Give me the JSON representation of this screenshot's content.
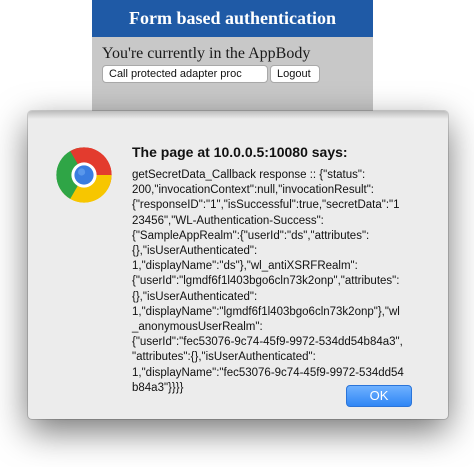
{
  "app": {
    "header_title": "Form based authentication",
    "body_text": "You're currently in the AppBody",
    "buttons": {
      "protected_label": "Call protected adapter proc",
      "logout_label": "Logout"
    }
  },
  "dialog": {
    "title": "The page at 10.0.0.5:10080 says:",
    "message": "getSecretData_Callback response :: {\"status\":\n200,\"invocationContext\":null,\"invocationResult\":\n{\"responseID\":\"1\",\"isSuccessful\":true,\"secretData\":\"1\n23456\",\"WL-Authentication-Success\":\n{\"SampleAppRealm\":{\"userId\":\"ds\",\"attributes\":\n{},\"isUserAuthenticated\":\n1,\"displayName\":\"ds\"},\"wl_antiXSRFRealm\":\n{\"userId\":\"lgmdf6f1l403bgo6cln73k2onp\",\"attributes\":\n{},\"isUserAuthenticated\":\n1,\"displayName\":\"lgmdf6f1l403bgo6cln73k2onp\"},\"wl\n_anonymousUserRealm\":\n{\"userId\":\"fec53076-9c74-45f9-9972-534dd54b84a3\",\n\"attributes\":{},\"isUserAuthenticated\":\n1,\"displayName\":\"fec53076-9c74-45f9-9972-534dd54\nb84a3\"}}}}",
    "ok_label": "OK",
    "icon": "chrome-icon"
  },
  "colors": {
    "header_bg": "#1f5aa6",
    "app_body_bg": "#c8c8c8",
    "dialog_bg": "#ececec",
    "ok_button": "#2f86f5"
  }
}
